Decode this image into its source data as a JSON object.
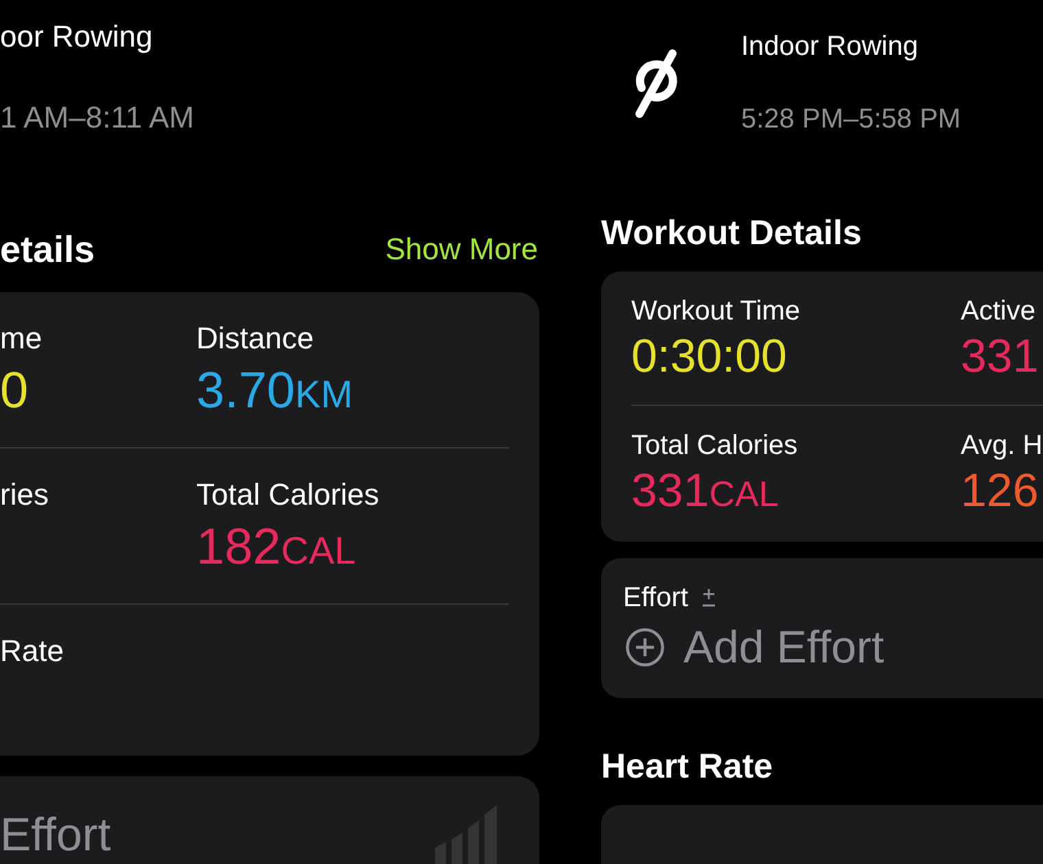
{
  "left_screen": {
    "title": "oor Rowing",
    "time": "1 AM–8:11 AM",
    "details": {
      "heading": "etails",
      "link": "Show More",
      "rows": [
        [
          {
            "label": "me",
            "value": "0",
            "color": "#e6e12b"
          },
          {
            "label": "Distance",
            "value": "3.70",
            "unit": "KM",
            "color": "#2aa9e8"
          }
        ],
        [
          {
            "label": "ries"
          },
          {
            "label": "Total Calories",
            "value": "182",
            "unit": "CAL",
            "color": "#e62a5b"
          }
        ],
        [
          {
            "label": "Rate"
          }
        ]
      ]
    },
    "effort": {
      "label": "Effort"
    }
  },
  "right_screen": {
    "title": "Indoor Rowing",
    "time": "5:28 PM–5:58 PM",
    "details": {
      "heading": "Workout Details",
      "rows": [
        [
          {
            "label": "Workout Time",
            "value": "0:30:00",
            "color": "#e6e12b"
          },
          {
            "label": "Active",
            "value": "331",
            "color": "#e62a5b"
          }
        ],
        [
          {
            "label": "Total Calories",
            "value": "331",
            "unit": "CAL",
            "color": "#e62a5b"
          },
          {
            "label": "Avg. H",
            "value": "126",
            "color": "#ef5a2c"
          }
        ]
      ]
    },
    "effort": {
      "label": "Effort",
      "button": "Add Effort"
    },
    "heart_rate": {
      "heading": "Heart Rate"
    }
  }
}
